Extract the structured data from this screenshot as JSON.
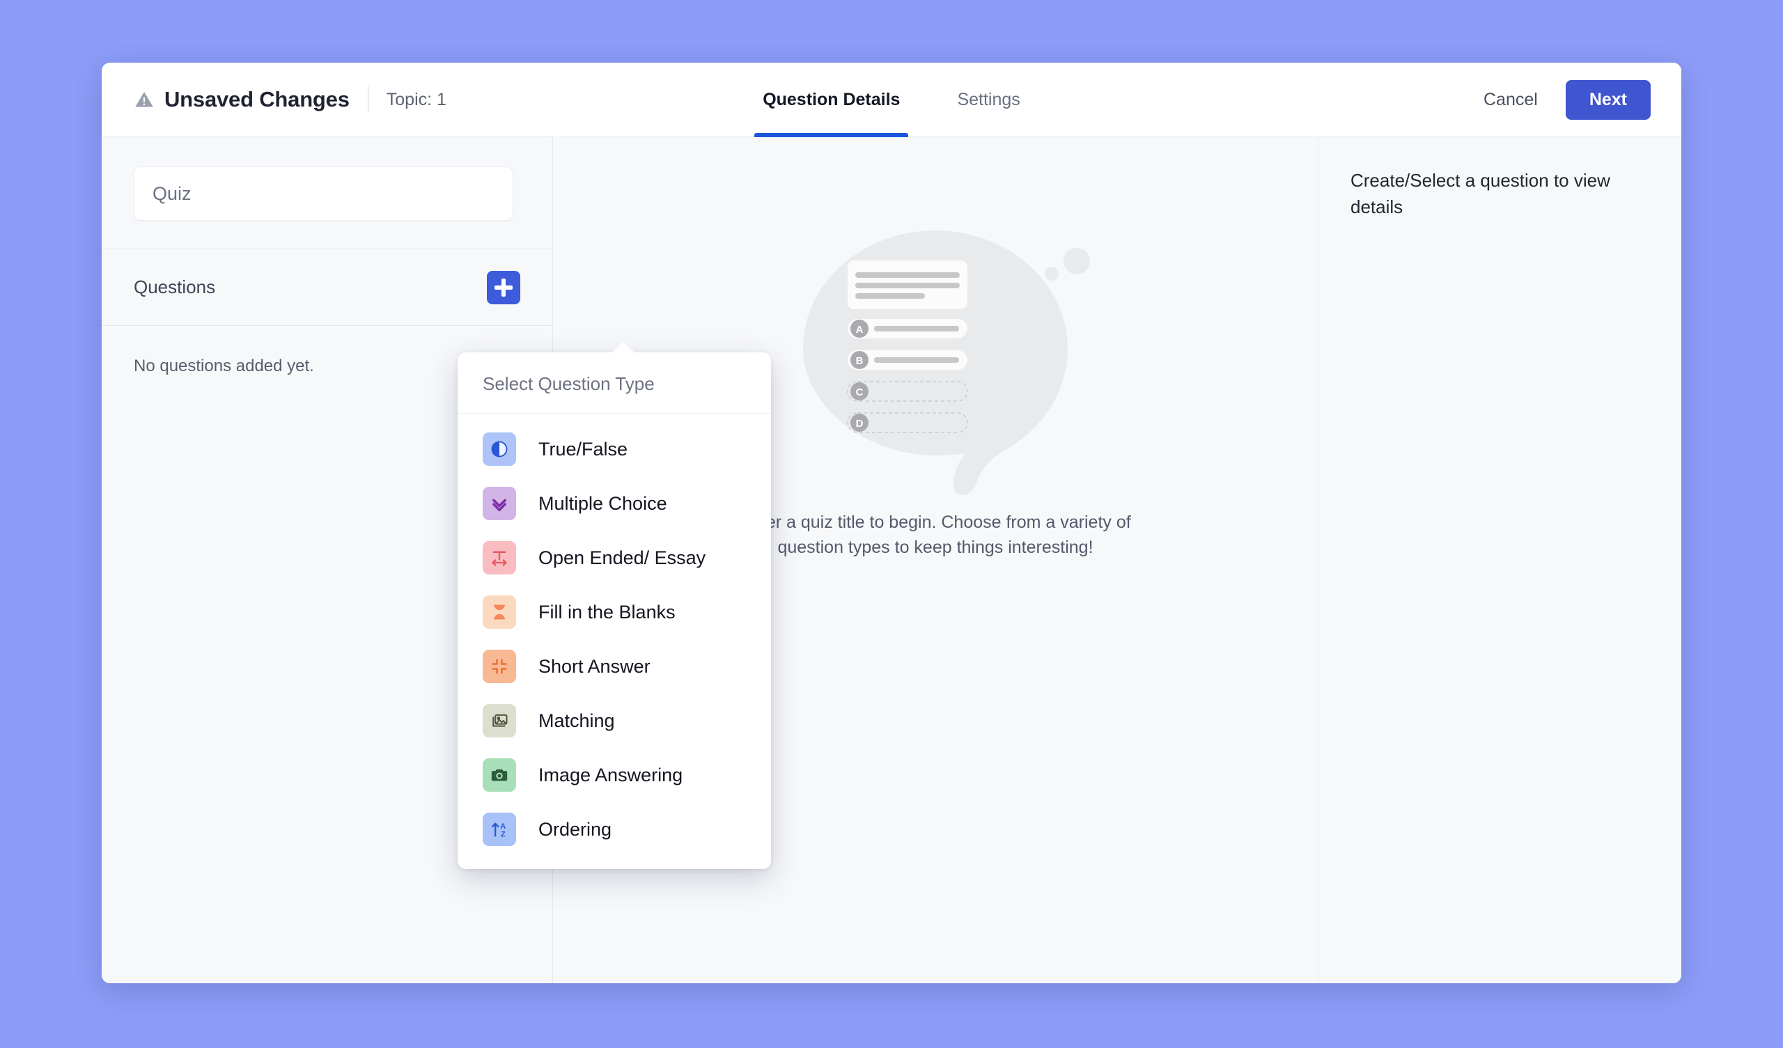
{
  "theme": {
    "page_background": "#8c9cf7",
    "primary_button": "#4055d0",
    "accent_tab_underline": "#1a56db",
    "add_button": "#3d5bdb"
  },
  "header": {
    "warning_icon": "warning-triangle-icon",
    "unsaved_title": "Unsaved Changes",
    "topic_label": "Topic: 1",
    "tabs": [
      {
        "label": "Question Details",
        "active": true
      },
      {
        "label": "Settings",
        "active": false
      }
    ],
    "cancel_label": "Cancel",
    "next_label": "Next"
  },
  "sidebar": {
    "quiz_title_value": "",
    "quiz_title_placeholder": "Quiz",
    "questions_label": "Questions",
    "add_button_icon": "plus-icon",
    "empty_state": "No questions added yet."
  },
  "dropdown": {
    "title": "Select Question Type",
    "items": [
      {
        "label": "True/False",
        "icon": "contrast-circle-icon",
        "tile": "#aec4f9",
        "glyph": "#2b57d4"
      },
      {
        "label": "Multiple Choice",
        "icon": "double-check-icon",
        "tile": "#d3b4e6",
        "glyph": "#7b2fa8"
      },
      {
        "label": "Open Ended/ Essay",
        "icon": "text-width-icon",
        "tile": "#f9bcc0",
        "glyph": "#e8565f"
      },
      {
        "label": "Fill in the Blanks",
        "icon": "hourglass-icon",
        "tile": "#fbd9bf",
        "glyph": "#f4875a"
      },
      {
        "label": "Short Answer",
        "icon": "collapse-arrows-icon",
        "tile": "#f9b894",
        "glyph": "#ea7032"
      },
      {
        "label": "Matching",
        "icon": "image-stack-icon",
        "tile": "#dcdfcd",
        "glyph": "#51543f"
      },
      {
        "label": "Image Answering",
        "icon": "camera-icon",
        "tile": "#a7e0b8",
        "glyph": "#2f5a3d"
      },
      {
        "label": "Ordering",
        "icon": "sort-az-icon",
        "tile": "#a8c2f8",
        "glyph": "#2957d6"
      }
    ]
  },
  "main": {
    "illustration": "quiz-speech-bubble-illustration",
    "option_letters": [
      "A",
      "B",
      "C",
      "D"
    ],
    "empty_message": "Enter a quiz title to begin. Choose from a variety of question types to keep things interesting!"
  },
  "right_panel": {
    "hint": "Create/Select a question to view details"
  }
}
